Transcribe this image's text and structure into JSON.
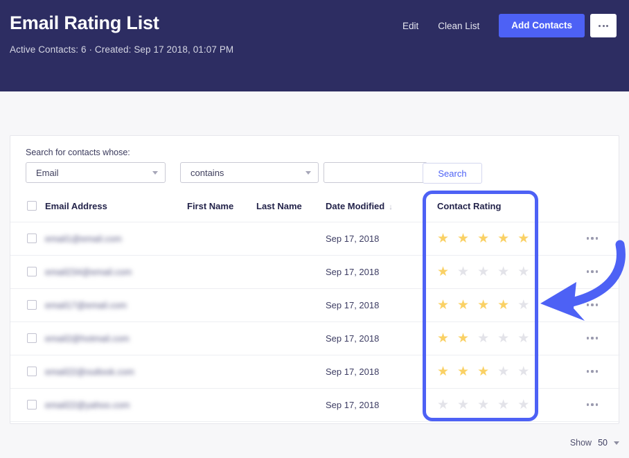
{
  "colors": {
    "header_bg": "#2d2d62",
    "accent_blue": "#4d61f5",
    "star_on": "#fad165",
    "star_off": "#e3e3e9",
    "page_bg": "#f7f7f9"
  },
  "header": {
    "title": "Email Rating List",
    "meta": "Active Contacts: 6  ·  Created: Sep 17 2018, 01:07 PM",
    "edit_label": "Edit",
    "clean_list_label": "Clean List",
    "add_contacts_label": "Add Contacts",
    "overflow_label": "more-options"
  },
  "search": {
    "label": "Search for contacts whose:",
    "field_value": "Email",
    "operator_value": "contains",
    "term_value": "",
    "term_placeholder": "",
    "button_label": "Search"
  },
  "table": {
    "columns": {
      "email": "Email Address",
      "first_name": "First Name",
      "last_name": "Last Name",
      "date_modified": "Date Modified",
      "sort_indicator": "↓",
      "contact_rating": "Contact Rating"
    },
    "rows": [
      {
        "email": "email1@email.com",
        "first_name": "",
        "last_name": "",
        "date": "Sep 17, 2018",
        "rating": 5
      },
      {
        "email": "email234@email.com",
        "first_name": "",
        "last_name": "",
        "date": "Sep 17, 2018",
        "rating": 1
      },
      {
        "email": "email17@email.com",
        "first_name": "",
        "last_name": "",
        "date": "Sep 17, 2018",
        "rating": 4
      },
      {
        "email": "email2@hotmail.com",
        "first_name": "",
        "last_name": "",
        "date": "Sep 17, 2018",
        "rating": 2
      },
      {
        "email": "email22@outlook.com",
        "first_name": "",
        "last_name": "",
        "date": "Sep 17, 2018",
        "rating": 3
      },
      {
        "email": "email22@yahoo.com",
        "first_name": "",
        "last_name": "",
        "date": "Sep 17, 2018",
        "rating": 0
      }
    ]
  },
  "footer": {
    "show_label": "Show",
    "page_size": "50"
  },
  "annotation": {
    "type": "curved-arrow",
    "points_to": "contact-rating-column",
    "color": "#4d61f5"
  }
}
